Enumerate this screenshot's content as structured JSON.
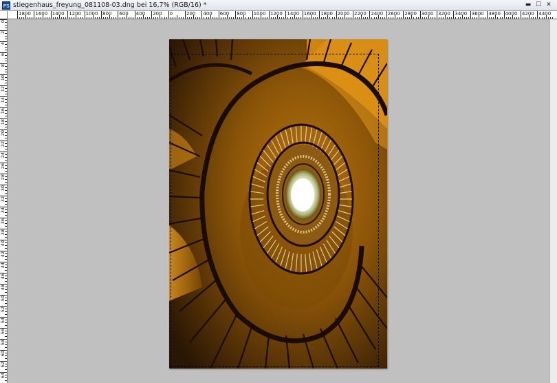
{
  "window": {
    "app_icon": "PS",
    "title": "stiegenhaus_freyung_081108-03.dng bei 16,7% (RGB/16) *",
    "controls": {
      "minimize": "▬",
      "maximize": "☐",
      "close": "✕"
    }
  },
  "ruler": {
    "horizontal_labels": [
      "1800",
      "1600",
      "1400",
      "1200",
      "1000",
      "800",
      "600",
      "400",
      "200",
      "0",
      "200",
      "400",
      "600",
      "800",
      "1000",
      "1200",
      "1400",
      "1600",
      "1800",
      "2000",
      "2200",
      "2400",
      "2600",
      "2800",
      "3000",
      "3200",
      "3400",
      "3600",
      "3800",
      "4000",
      "4200",
      "4400"
    ],
    "vertical_labels": [
      "0",
      "2",
      "4",
      "6",
      "8",
      "10",
      "12",
      "14",
      "16",
      "18",
      "20",
      "22",
      "24",
      "26",
      "28",
      "30",
      "32",
      "34",
      "36",
      "38",
      "40",
      "42",
      "44",
      "46",
      "48",
      "50",
      "52",
      "54",
      "56",
      "58",
      "60",
      "62",
      "64",
      "66"
    ]
  },
  "document": {
    "image_subject": "spiral staircase viewed from below",
    "colors": {
      "background": "#c0c0c0",
      "stair_dark": "#2a1604",
      "stair_mid": "#8a5408",
      "stair_light": "#f0a020",
      "skylight": "#ffffff"
    },
    "selection": "marquee"
  }
}
